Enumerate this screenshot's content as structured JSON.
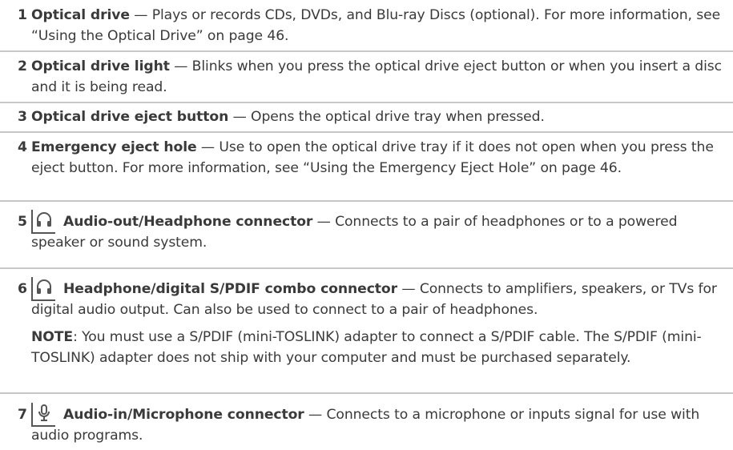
{
  "items": [
    {
      "num": "1",
      "term": "Optical drive",
      "desc": " — Plays or records CDs, DVDs, and Blu-ray Discs (optional). For more information, see “Using the Optical Drive” on page 46."
    },
    {
      "num": "2",
      "term": "Optical drive light",
      "desc": " — Blinks when you press the optical drive eject button or when you insert a disc and it is being read."
    },
    {
      "num": "3",
      "term": "Optical drive eject button",
      "desc": " — Opens the optical drive tray when pressed."
    },
    {
      "num": "4",
      "term": "Emergency eject hole",
      "desc": " — Use to open the optical drive tray if it does not open when you press the eject button. For more information, see “Using the Emergency Eject Hole” on page 46."
    },
    {
      "num": "5",
      "icon": "headphone-icon",
      "term": "Audio-out/Headphone connector",
      "desc": " — Connects to a pair of headphones or to a powered speaker or sound system."
    },
    {
      "num": "6",
      "icon": "headphone-icon",
      "term": "Headphone/digital S/PDIF combo connector",
      "desc": " — Connects to amplifiers, speakers, or TVs for digital audio output. Can also be used to connect to a pair of headphones.",
      "note_label": "NOTE",
      "note_text": ": You must use a S/PDIF (mini-TOSLINK) adapter to connect a S/PDIF cable. The S/PDIF (mini-TOSLINK) adapter does not ship with your computer and must be purchased separately."
    },
    {
      "num": "7",
      "icon": "microphone-icon",
      "term": "Audio-in/Microphone connector",
      "desc": " — Connects to a microphone or inputs signal for use with audio programs."
    }
  ]
}
